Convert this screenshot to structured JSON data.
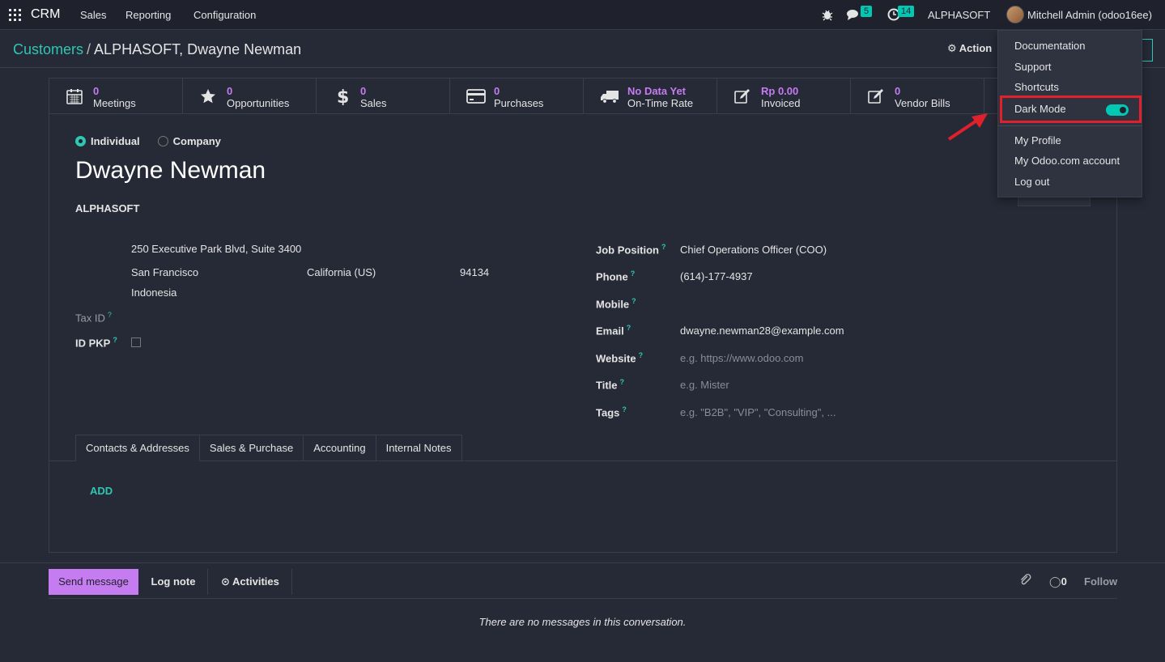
{
  "navbar": {
    "brand": "CRM",
    "menus": [
      "Sales",
      "Reporting",
      "Configuration"
    ],
    "messages_count": "5",
    "activities_count": "14",
    "company": "ALPHASOFT",
    "user": "Mitchell Admin (odoo16ee)"
  },
  "control_panel": {
    "breadcrumb_parent": "Customers",
    "breadcrumb_separator": "/",
    "breadcrumb_current": "ALPHASOFT, Dwayne Newman",
    "action_label": "Action"
  },
  "stat_buttons": [
    {
      "value": "0",
      "label": "Meetings",
      "icon": "calendar-icon"
    },
    {
      "value": "0",
      "label": "Opportunities",
      "icon": "star-icon"
    },
    {
      "value": "0",
      "label": "Sales",
      "icon": "dollar-icon"
    },
    {
      "value": "0",
      "label": "Purchases",
      "icon": "credit-card-icon"
    },
    {
      "value": "No Data Yet",
      "label": "On-Time Rate",
      "icon": "truck-icon"
    },
    {
      "value": "Rp 0.00",
      "label": "Invoiced",
      "icon": "edit-icon"
    },
    {
      "value": "0",
      "label": "Vendor Bills",
      "icon": "edit-icon"
    }
  ],
  "form": {
    "type_individual": "Individual",
    "type_company": "Company",
    "name": "Dwayne Newman",
    "parent_company": "ALPHASOFT",
    "street": "250 Executive Park Blvd, Suite 3400",
    "city": "San Francisco",
    "state": "California (US)",
    "zip": "94134",
    "country": "Indonesia",
    "tax_id_label": "Tax ID",
    "id_pkp_label": "ID PKP",
    "help_mark": "?",
    "job_position_label": "Job Position",
    "job_position": "Chief Operations Officer (COO)",
    "phone_label": "Phone",
    "phone": "(614)-177-4937",
    "mobile_label": "Mobile",
    "email_label": "Email",
    "email": "dwayne.newman28@example.com",
    "website_label": "Website",
    "website_placeholder": "e.g. https://www.odoo.com",
    "title_label": "Title",
    "title_placeholder": "e.g. Mister",
    "tags_label": "Tags",
    "tags_placeholder": "e.g. \"B2B\", \"VIP\", \"Consulting\", ..."
  },
  "tabs": [
    "Contacts & Addresses",
    "Sales & Purchase",
    "Accounting",
    "Internal Notes"
  ],
  "add_label": "ADD",
  "chatter": {
    "send_message": "Send message",
    "log_note": "Log note",
    "activities": "Activities",
    "followers_count": "0",
    "follow": "Follow",
    "empty": "There are no messages in this conversation."
  },
  "user_menu": {
    "items_top": [
      "Documentation",
      "Support",
      "Shortcuts"
    ],
    "dark_mode": "Dark Mode",
    "dark_mode_enabled": true,
    "items_bottom": [
      "My Profile",
      "My Odoo.com account",
      "Log out"
    ]
  },
  "colors": {
    "accent": "#2ec7b3",
    "purple": "#c57cf0",
    "background": "#262a36",
    "highlight": "#e0202a"
  }
}
